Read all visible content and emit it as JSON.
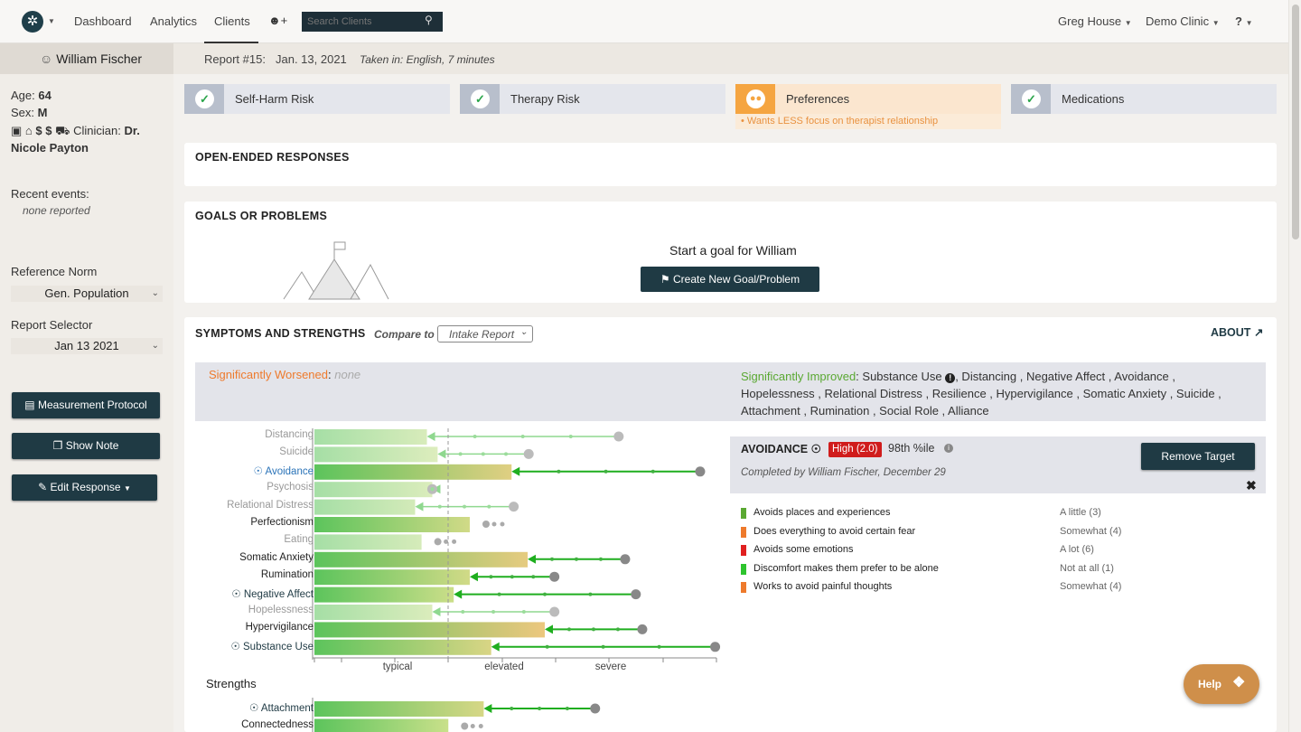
{
  "navbar": {
    "dashboard": "Dashboard",
    "analytics": "Analytics",
    "clients": "Clients",
    "search_placeholder": "Search Clients",
    "user": "Greg House",
    "clinic": "Demo Clinic"
  },
  "patient": {
    "name": "William Fischer",
    "age_label": "Age:",
    "age": "64",
    "sex_label": "Sex:",
    "sex": "M",
    "symbols": "$ $",
    "clinician_label": "Clinician:",
    "clinician_a": "Dr.",
    "clinician_b": "Nicole Payton",
    "recent_label": "Recent events:",
    "recent_value": "none reported"
  },
  "sidebar": {
    "ref_norm_label": "Reference Norm",
    "ref_norm": "Gen. Population",
    "report_sel_label": "Report Selector",
    "report_sel": "Jan 13 2021",
    "btn_protocol": "Measurement Protocol",
    "btn_note": "Show Note",
    "btn_edit": "Edit Response"
  },
  "report": {
    "number": "Report #15:",
    "date": "Jan. 13, 2021",
    "taken": "Taken in: English, 7 minutes"
  },
  "risks": [
    {
      "label": "Self-Harm Risk"
    },
    {
      "label": "Therapy Risk"
    },
    {
      "label": "Preferences",
      "note": "Wants LESS focus on therapist relationship"
    },
    {
      "label": "Medications"
    }
  ],
  "open_ended": {
    "title": "OPEN-ENDED RESPONSES"
  },
  "goals": {
    "title": "GOALS OR PROBLEMS",
    "prompt": "Start a goal for William",
    "button": "Create New Goal/Problem"
  },
  "symptoms": {
    "title": "SYMPTOMS AND STRENGTHS",
    "compare_label": "Compare to",
    "compare_value": "Intake Report",
    "about": "ABOUT",
    "worsened_label": "Significantly Worsened",
    "worsened_value": "none",
    "improved_label": "Significantly Improved",
    "improved_l1": "Substance Use",
    "improved_l1b": ", Distancing , Negative Affect , Avoidance ,",
    "improved_l2": "Hopelessness , Relational Distress , Resilience , Hypervigilance , Somatic Anxiety , Suicide ,",
    "improved_l3": "Attachment , Rumination , Social Role , Alliance",
    "axis": [
      "typical",
      "elevated",
      "severe"
    ],
    "strengths_title": "Strengths"
  },
  "detail": {
    "title": "AVOIDANCE",
    "badge": "High (2.0)",
    "percentile": "98th %ile",
    "completed": "Completed by William Fischer, December 29",
    "remove": "Remove Target",
    "items": [
      {
        "text": "Avoids places and experiences",
        "answer": "A little (3)",
        "color": "#5aa832"
      },
      {
        "text": "Does everything to avoid certain fear",
        "answer": "Somewhat (4)",
        "color": "#ee7a2c"
      },
      {
        "text": "Avoids some emotions",
        "answer": "A lot (6)",
        "color": "#e02020"
      },
      {
        "text": "Discomfort makes them prefer to be alone",
        "answer": "Not at all (1)",
        "color": "#2ec42e"
      },
      {
        "text": "Works to avoid painful thoughts",
        "answer": "Somewhat (4)",
        "color": "#ee7a2c"
      }
    ]
  },
  "help": "Help",
  "chart_data": {
    "type": "bar",
    "axis_labels": [
      "typical",
      "elevated",
      "severe"
    ],
    "x_scale": {
      "min": 0,
      "max": 3,
      "cutoff": 1.25
    },
    "categories": [
      "Distancing",
      "Suicide",
      "Avoidance",
      "Psychosis",
      "Relational Distress",
      "Perfectionism",
      "Eating",
      "Somatic Anxiety",
      "Rumination",
      "Negative Affect",
      "Hopelessness",
      "Hypervigilance",
      "Substance Use"
    ],
    "current": [
      1.05,
      1.15,
      1.84,
      1.1,
      0.94,
      1.45,
      1.0,
      1.99,
      1.45,
      1.3,
      1.1,
      2.15,
      1.65
    ],
    "intake": [
      2.84,
      2.0,
      3.6,
      1.1,
      1.86,
      null,
      null,
      2.9,
      2.24,
      3.0,
      2.24,
      3.06,
      3.74
    ],
    "dimmed": [
      true,
      true,
      false,
      true,
      true,
      false,
      true,
      false,
      false,
      false,
      true,
      false,
      false
    ],
    "targeted": [
      false,
      false,
      true,
      false,
      false,
      false,
      false,
      false,
      false,
      true,
      false,
      false,
      true
    ],
    "strengths": {
      "categories": [
        "Attachment",
        "Connectedness"
      ],
      "current": [
        1.58,
        1.25
      ],
      "intake": [
        2.62,
        null
      ],
      "targeted": [
        true,
        false
      ]
    }
  }
}
